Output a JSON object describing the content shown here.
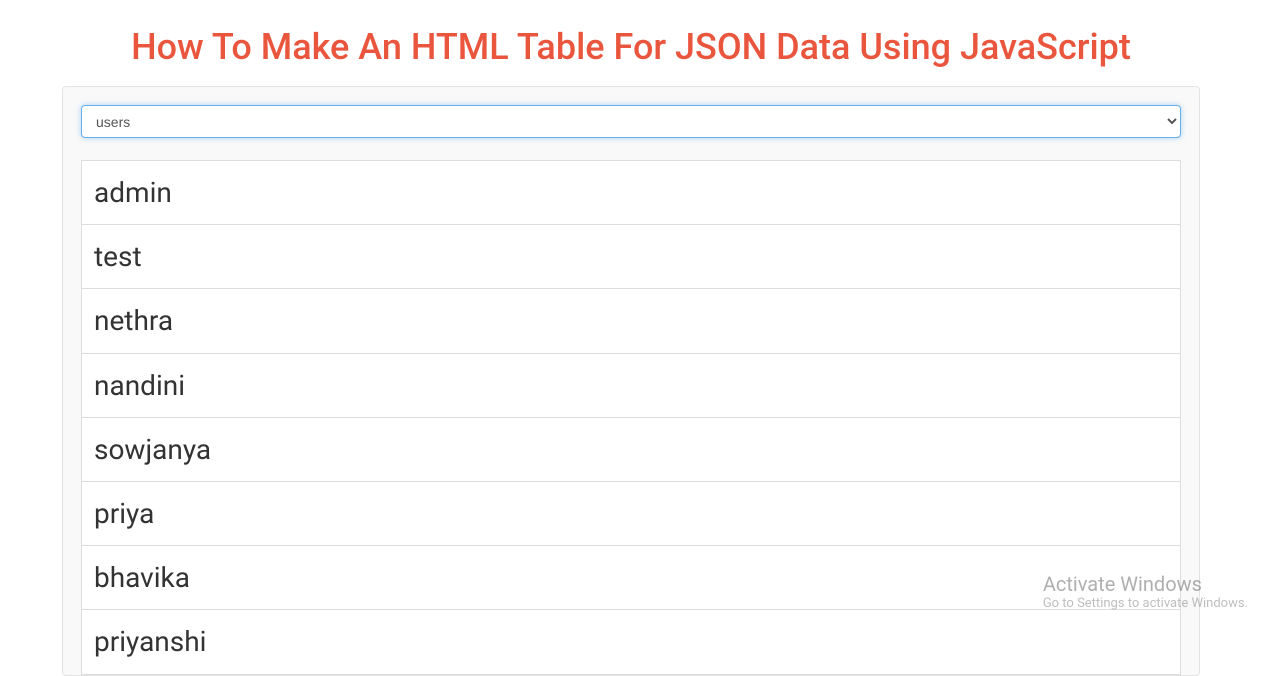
{
  "title": "How To Make An HTML Table For JSON Data Using JavaScript",
  "dropdown": {
    "selected": "users",
    "options": [
      "users"
    ]
  },
  "table": {
    "rows": [
      "admin",
      "test",
      "nethra",
      "nandini",
      "sowjanya",
      "priya",
      "bhavika",
      "priyanshi"
    ]
  },
  "watermark": {
    "title": "Activate Windows",
    "subtitle": "Go to Settings to activate Windows."
  }
}
